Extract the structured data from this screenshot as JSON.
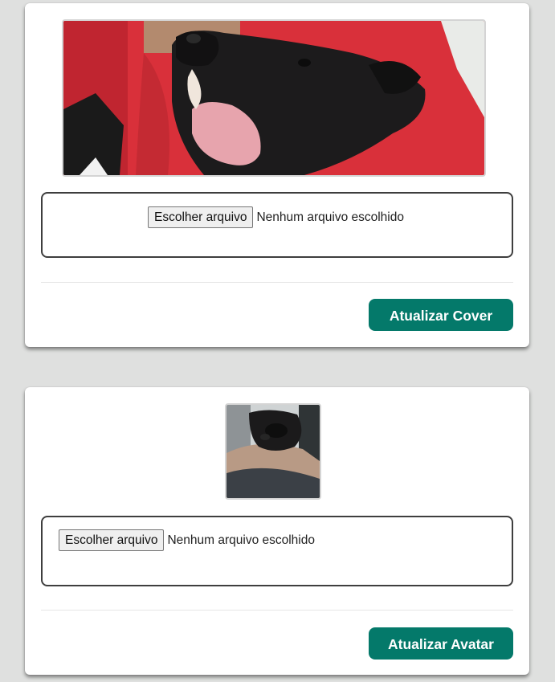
{
  "cover_section": {
    "file_button_label": "Escolher arquivo",
    "file_status": "Nenhum arquivo escolhido",
    "submit_label": "Atualizar Cover"
  },
  "avatar_section": {
    "file_button_label": "Escolher arquivo",
    "file_status": "Nenhum arquivo escolhido",
    "submit_label": "Atualizar Avatar"
  },
  "colors": {
    "page_background": "#dfe0df",
    "card_background": "#ffffff",
    "primary_button": "#04796a",
    "upload_border": "#3e3e3e"
  }
}
